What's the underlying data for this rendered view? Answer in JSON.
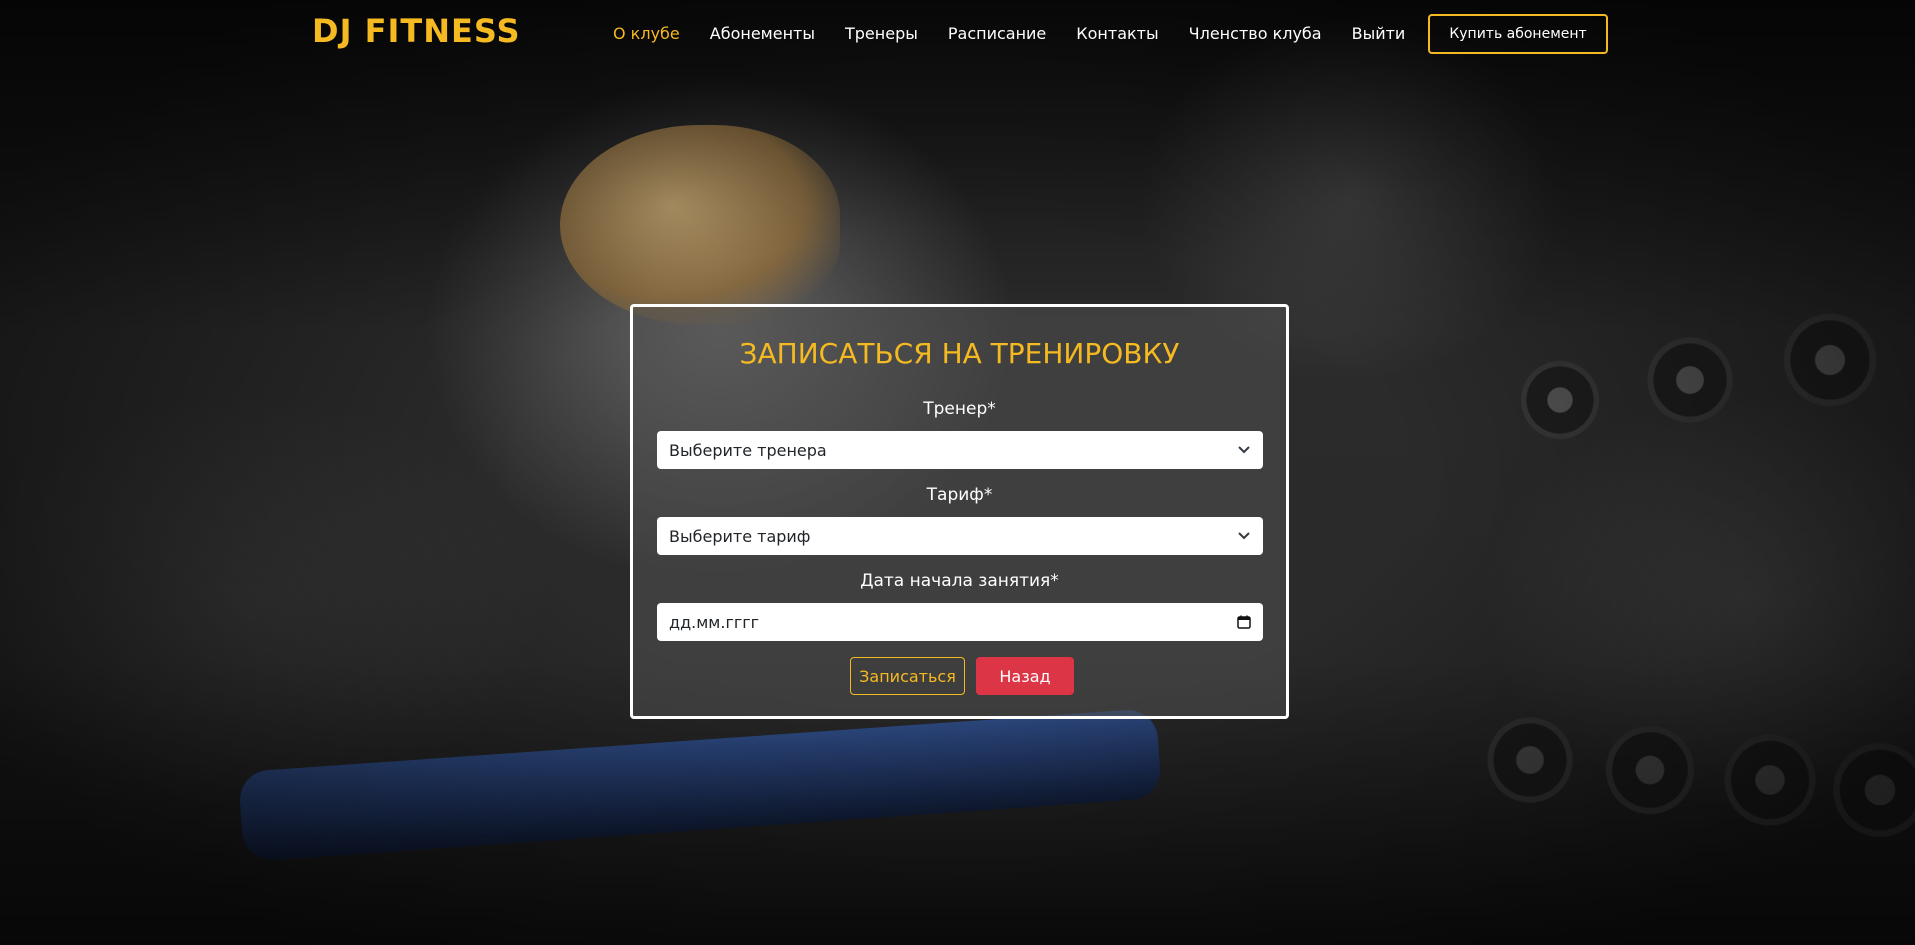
{
  "header": {
    "logo": "DJ FITNESS",
    "nav": [
      {
        "label": "О клубе",
        "active": true
      },
      {
        "label": "Абонементы",
        "active": false
      },
      {
        "label": "Тренеры",
        "active": false
      },
      {
        "label": "Расписание",
        "active": false
      },
      {
        "label": "Контакты",
        "active": false
      },
      {
        "label": "Членство клуба",
        "active": false
      },
      {
        "label": "Выйти",
        "active": false
      }
    ],
    "buy_button": "Купить абонемент"
  },
  "form": {
    "title": "ЗАПИСАТЬСЯ НА ТРЕНИРОВКУ",
    "trainer_label": "Тренер*",
    "trainer_value": "Выберите тренера",
    "tariff_label": "Тариф*",
    "tariff_value": "Выберите тариф",
    "date_label": "Дата начала занятия*",
    "date_value": "дд.мм.гггг",
    "submit_label": "Записаться",
    "back_label": "Назад"
  },
  "icons": {
    "select_chevron": "chevron-down-icon",
    "date_picker": "calendar-icon"
  },
  "colors": {
    "accent": "#f5b921",
    "danger": "#dc3545",
    "text_light": "#ffffff"
  }
}
